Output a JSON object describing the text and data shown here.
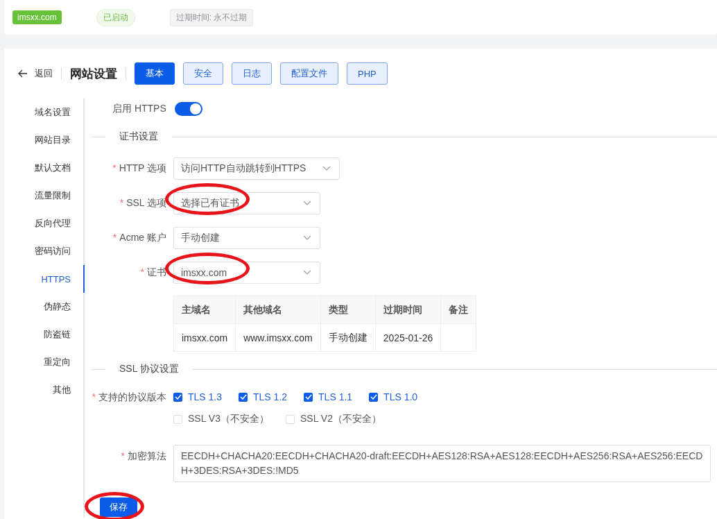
{
  "site_bar": {
    "domain": "imsxx.com",
    "status": "已启动",
    "expiry": "过期时间: 永不过期"
  },
  "header": {
    "back": "返回",
    "title": "网站设置",
    "tabs": [
      {
        "label": "基本",
        "selected": true
      },
      {
        "label": "安全",
        "selected": false
      },
      {
        "label": "日志",
        "selected": false
      },
      {
        "label": "配置文件",
        "selected": false
      },
      {
        "label": "PHP",
        "selected": false
      }
    ]
  },
  "sidebar": {
    "items": [
      {
        "label": "域名设置",
        "selected": false
      },
      {
        "label": "网站目录",
        "selected": false
      },
      {
        "label": "默认文档",
        "selected": false
      },
      {
        "label": "流量限制",
        "selected": false
      },
      {
        "label": "反向代理",
        "selected": false
      },
      {
        "label": "密码访问",
        "selected": false
      },
      {
        "label": "HTTPS",
        "selected": true
      },
      {
        "label": "伪静态",
        "selected": false
      },
      {
        "label": "防盗链",
        "selected": false
      },
      {
        "label": "重定向",
        "selected": false
      },
      {
        "label": "其他",
        "selected": false
      }
    ]
  },
  "https_toggle": {
    "label": "启用 HTTPS",
    "on": true
  },
  "cert_section": {
    "title": "证书设置",
    "fields": [
      {
        "marker": "*",
        "label": "HTTP 选项",
        "value": "访问HTTP自动跳转到HTTPS",
        "circled": false
      },
      {
        "marker": "*",
        "label": "SSL 选项",
        "value": "选择已有证书",
        "circled": true
      },
      {
        "marker": "*",
        "label": "Acme 账户",
        "value": "手动创建",
        "circled": false
      },
      {
        "marker": "*",
        "label": "证书",
        "value": "imsxx.com",
        "circled": true
      }
    ],
    "table": {
      "columns": [
        "主域名",
        "其他域名",
        "类型",
        "过期时间",
        "备注"
      ],
      "rows": [
        [
          "imsxx.com",
          "www.imsxx.com",
          "手动创建",
          "2025-01-26",
          ""
        ]
      ]
    }
  },
  "ssl_section": {
    "title": "SSL 协议设置",
    "protocols_marker": "*",
    "protocols_label": "支持的协议版本",
    "protocols": [
      {
        "label": "TLS 1.3",
        "checked": true
      },
      {
        "label": "TLS 1.2",
        "checked": true
      },
      {
        "label": "TLS 1.1",
        "checked": true
      },
      {
        "label": "TLS 1.0",
        "checked": true
      },
      {
        "label": "SSL V3（不安全）",
        "checked": false
      },
      {
        "label": "SSL V2（不安全）",
        "checked": false
      }
    ],
    "cipher_marker": "*",
    "cipher_label": "加密算法",
    "cipher": "EECDH+CHACHA20:EECDH+CHACHA20-draft:EECDH+AES128:RSA+AES128:EECDH+AES256:RSA+AES256:EECDH+3DES:RSA+3DES:!MD5"
  },
  "save": {
    "label": "保存",
    "circled": true
  }
}
